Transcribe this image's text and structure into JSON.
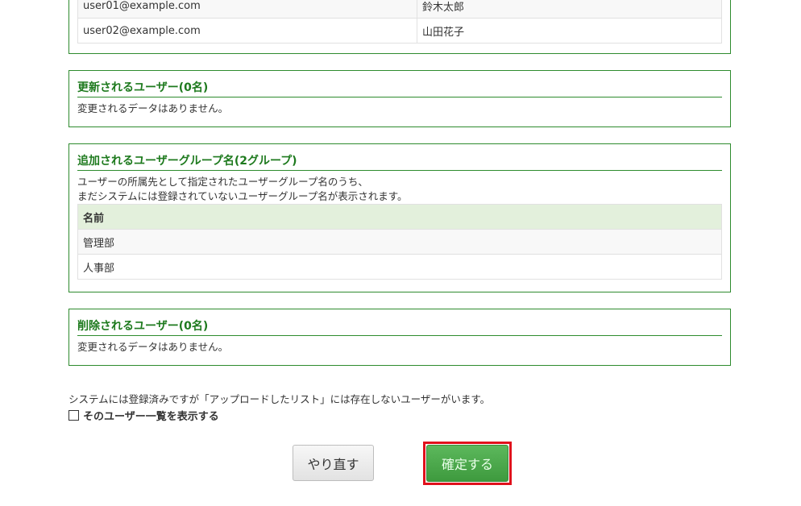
{
  "users_table": {
    "rows": [
      {
        "email": "user01@example.com",
        "name": "鈴木太郎"
      },
      {
        "email": "user02@example.com",
        "name": "山田花子"
      }
    ]
  },
  "updated_users": {
    "title": "更新されるユーザー(0名)",
    "message": "変更されるデータはありません。"
  },
  "added_groups": {
    "title": "追加されるユーザーグループ名(2グループ)",
    "desc_line1": "ユーザーの所属先として指定されたユーザーグループ名のうち、",
    "desc_line2": "まだシステムには登録されていないユーザーグループ名が表示されます。",
    "column_header": "名前",
    "rows": [
      "管理部",
      "人事部"
    ]
  },
  "deleted_users": {
    "title": "削除されるユーザー(0名)",
    "message": "変更されるデータはありません。"
  },
  "notice": "システムには登録済みですが「アップロードしたリスト」には存在しないユーザーがいます。",
  "show_list_label": "そのユーザー一覧を表示する",
  "buttons": {
    "redo": "やり直す",
    "confirm": "確定する"
  },
  "colors": {
    "accent_green": "#2e8b2e",
    "highlight_red": "#e0111c"
  }
}
